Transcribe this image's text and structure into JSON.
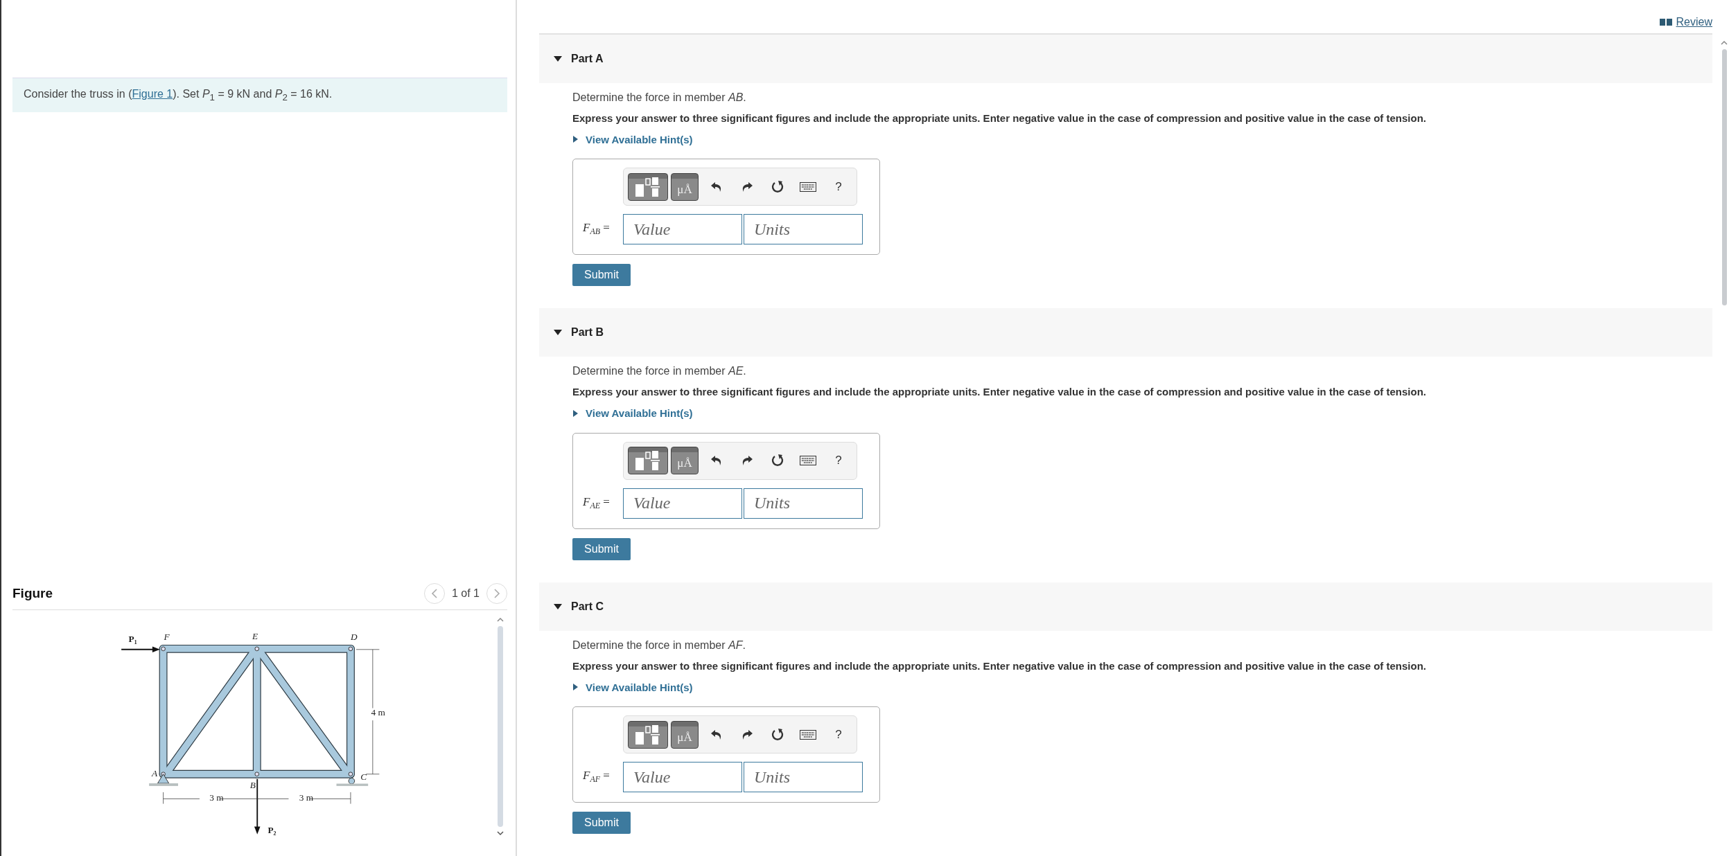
{
  "review_link": "Review",
  "problem": {
    "before": "Consider the truss in (",
    "link": "Figure 1",
    "after": "). Set *P*$_{1}$ = 9 kN and *P*$_{2}$ = 16 kN."
  },
  "figure": {
    "title": "Figure",
    "pager": "1 of 1",
    "labels": [
      "P₁",
      "F",
      "E",
      "D",
      "4 m",
      "A",
      "B",
      "C",
      "3 m",
      "3 m",
      "P₂"
    ]
  },
  "parts": [
    {
      "label": "Part A",
      "expanded": true,
      "prompt": "Determine the force in member *AB*.",
      "instruction": "Express your answer to three significant figures and include the appropriate units. Enter negative value in the case of compression and positive value in the case of tension.",
      "hint": "View Available Hint(s)",
      "symbol": "μÅ",
      "help": "?",
      "variable": "*F*$_{AB}$ =",
      "value_placeholder": "Value",
      "units_placeholder": "Units",
      "submit": "Submit"
    },
    {
      "label": "Part B",
      "expanded": true,
      "prompt": "Determine the force in member *AE*.",
      "instruction": "Express your answer to three significant figures and include the appropriate units. Enter negative value in the case of compression and positive value in the case of tension.",
      "hint": "View Available Hint(s)",
      "symbol": "μÅ",
      "help": "?",
      "variable": "*F*$_{AE}$ =",
      "value_placeholder": "Value",
      "units_placeholder": "Units",
      "submit": "Submit"
    },
    {
      "label": "Part C",
      "expanded": true,
      "prompt": "Determine the force in member *AF*.",
      "instruction": "Express your answer to three significant figures and include the appropriate units. Enter negative value in the case of compression and positive value in the case of tension.",
      "hint": "View Available Hint(s)",
      "symbol": "μÅ",
      "help": "?",
      "variable": "*F*$_{AF}$ =",
      "value_placeholder": "Value",
      "units_placeholder": "Units",
      "submit": "Submit"
    }
  ]
}
